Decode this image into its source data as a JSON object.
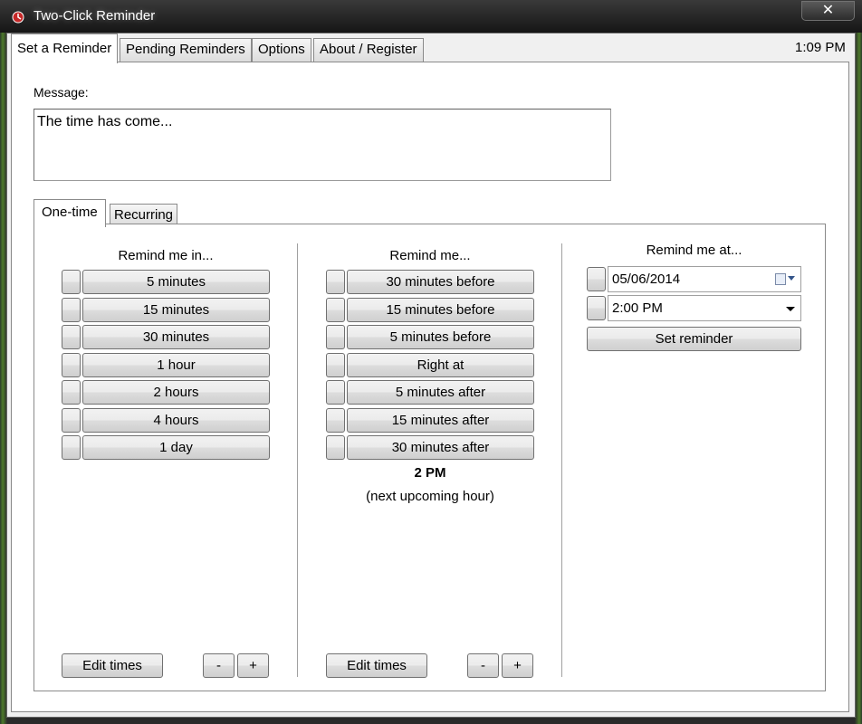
{
  "window": {
    "title": "Two-Click Reminder",
    "close_glyph": "✕"
  },
  "clock": "1:09 PM",
  "tabs": [
    "Set a Reminder",
    "Pending Reminders",
    "Options",
    "About / Register"
  ],
  "message": {
    "label": "Message:",
    "value": "The time has come..."
  },
  "subtabs": [
    "One-time",
    "Recurring"
  ],
  "col1": {
    "heading": "Remind me in...",
    "buttons": [
      "5 minutes",
      "15 minutes",
      "30 minutes",
      "1 hour",
      "2 hours",
      "4 hours",
      "1 day"
    ],
    "edit_label": "Edit times",
    "minus": "-",
    "plus": "+"
  },
  "col2": {
    "heading": "Remind me...",
    "buttons": [
      "30 minutes before",
      "15 minutes before",
      "5 minutes before",
      "Right at",
      "5 minutes after",
      "15 minutes after",
      "30 minutes after"
    ],
    "target_time": "2 PM",
    "target_note": "(next upcoming hour)",
    "edit_label": "Edit times",
    "minus": "-",
    "plus": "+"
  },
  "col3": {
    "heading": "Remind me at...",
    "date_value": "05/06/2014",
    "time_value": "2:00 PM",
    "set_label": "Set reminder"
  },
  "icons": {
    "app": "alarm-icon",
    "calendar": "calendar-icon",
    "dropdown": "chevron-down-icon"
  }
}
